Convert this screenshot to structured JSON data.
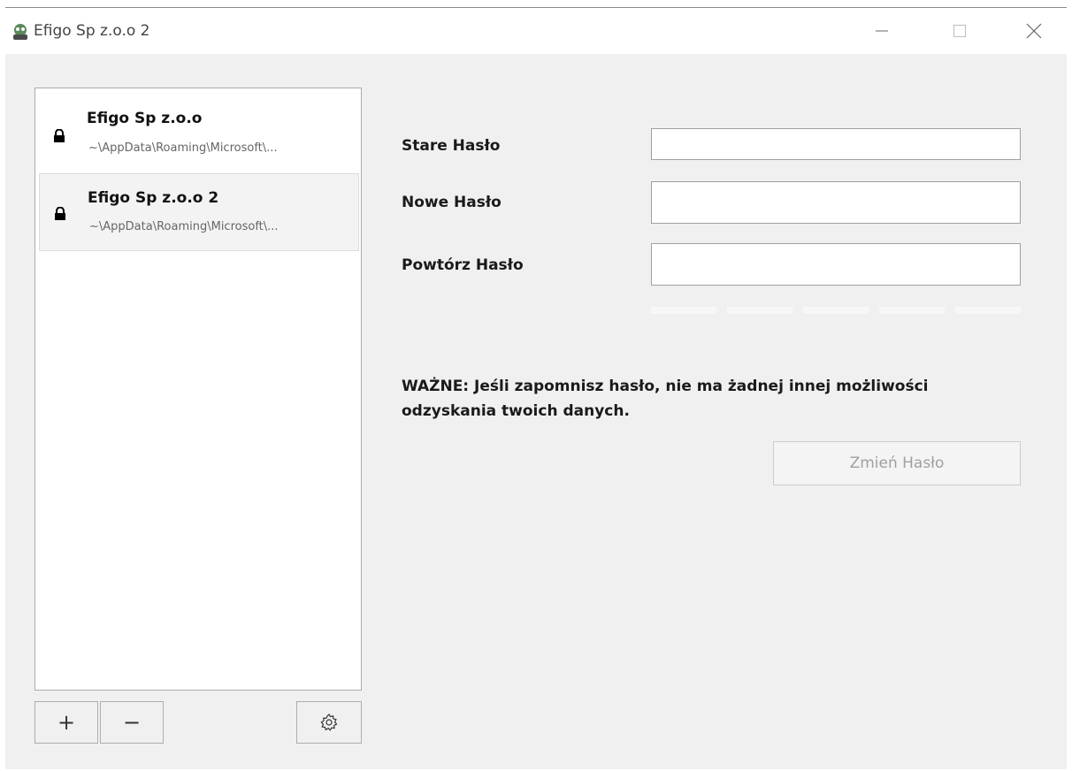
{
  "window": {
    "title": "Efigo Sp z.o.o 2"
  },
  "sidebar": {
    "items": [
      {
        "name": "Efigo Sp z.o.o",
        "path": "~\\AppData\\Roaming\\Microsoft\\...",
        "icon": "lock-icon",
        "selected": false
      },
      {
        "name": "Efigo Sp z.o.o 2",
        "path": "~\\AppData\\Roaming\\Microsoft\\...",
        "icon": "lock-icon",
        "selected": true
      }
    ],
    "add_label": "+",
    "remove_label": "−",
    "settings_icon": "gear-icon"
  },
  "form": {
    "old_password_label": "Stare Hasło",
    "new_password_label": "Nowe Hasło",
    "repeat_password_label": "Powtórz Hasło",
    "old_password_value": "",
    "new_password_value": "",
    "repeat_password_value": "",
    "warning": "WAŻNE: Jeśli zapomnisz hasło, nie ma żadnej innej możliwości odzyskania twoich danych.",
    "change_button_label": "Zmień Hasło",
    "change_button_enabled": false
  },
  "colors": {
    "window_bg": "#f0f0f0",
    "disabled_text": "#a0a0a0"
  }
}
